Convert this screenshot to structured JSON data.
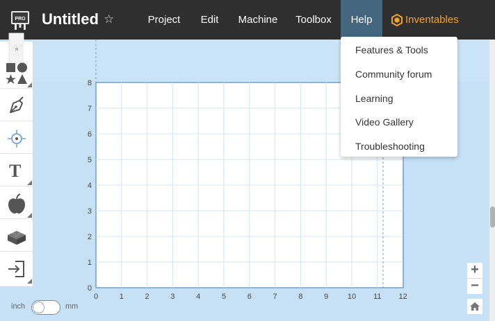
{
  "header": {
    "title": "Untitled",
    "logo_badge": "PRO",
    "star_glyph": "☆",
    "menu": [
      {
        "label": "Project"
      },
      {
        "label": "Edit"
      },
      {
        "label": "Machine"
      },
      {
        "label": "Toolbox"
      },
      {
        "label": "Help",
        "active": true
      }
    ],
    "brand_link": "Inventables"
  },
  "help_menu": {
    "items": [
      {
        "label": "Features & Tools"
      },
      {
        "label": "Community forum"
      },
      {
        "label": "Learning"
      },
      {
        "label": "Video Gallery"
      },
      {
        "label": "Troubleshooting"
      }
    ]
  },
  "toolbar": {
    "collapse_glyph": "«",
    "tools": [
      {
        "name": "shapes",
        "icon": "shapes-icon"
      },
      {
        "name": "pen",
        "icon": "pen-icon"
      },
      {
        "name": "point",
        "icon": "target-icon"
      },
      {
        "name": "text",
        "icon": "text-icon",
        "glyph": "T"
      },
      {
        "name": "icon-library",
        "icon": "apple-icon"
      },
      {
        "name": "apps",
        "icon": "lego-brick-icon"
      },
      {
        "name": "import",
        "icon": "import-icon"
      }
    ]
  },
  "canvas": {
    "x_axis_ticks": [
      "0",
      "1",
      "2",
      "3",
      "4",
      "5",
      "6",
      "7",
      "8",
      "9",
      "10",
      "11",
      "12"
    ],
    "y_axis_ticks": [
      "0",
      "1",
      "2",
      "3",
      "4",
      "5",
      "6",
      "7",
      "8"
    ]
  },
  "zoom": {
    "zoom_in": "+",
    "zoom_out": "−"
  },
  "units": {
    "left_label": "inch",
    "right_label": "mm",
    "selected": "inch"
  },
  "colors": {
    "topbar": "#2f2f2f",
    "active_menu": "#44667f",
    "brand": "#f0a430",
    "canvas_bg": "#c6e0f5",
    "grid_line": "#d4e5f3",
    "material_border": "#6f9fcb"
  }
}
